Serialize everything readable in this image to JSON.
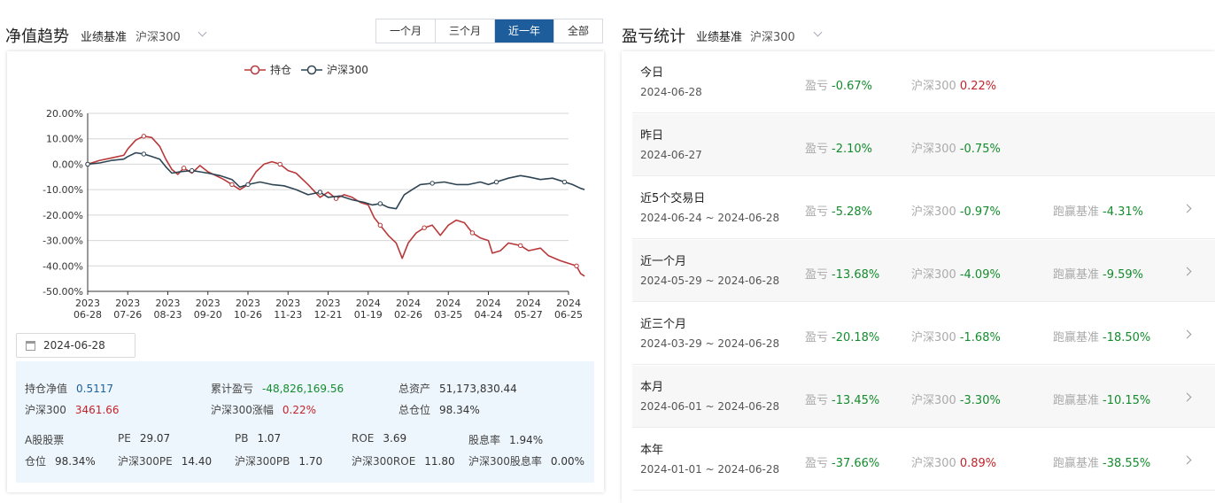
{
  "left": {
    "title": "净值趋势",
    "benchmark_label": "业绩基准",
    "benchmark_value": "沪深300",
    "range_tabs": [
      "一个月",
      "三个月",
      "近一年",
      "全部"
    ],
    "active_tab": 2,
    "date": "2024-06-28",
    "stats": {
      "nav_label": "持仓净值",
      "nav_value": "0.5117",
      "cum_pl_label": "累计盈亏",
      "cum_pl_value": "-48,826,169.56",
      "assets_label": "总资产",
      "assets_value": "51,173,830.44",
      "hs300_label": "沪深300",
      "hs300_value": "3461.66",
      "hs300_chg_label": "沪深300涨幅",
      "hs300_chg_value": "0.22%",
      "position_total_label": "总仓位",
      "position_total_value": "98.34%",
      "a_share_label": "A股股票",
      "pe_label": "PE",
      "pe_value": "29.07",
      "pb_label": "PB",
      "pb_value": "1.07",
      "roe_label": "ROE",
      "roe_value": "3.69",
      "div_label": "股息率",
      "div_value": "1.94%",
      "pos_label": "仓位",
      "pos_value": "98.34%",
      "hs_pe_label": "沪深300PE",
      "hs_pe_value": "14.40",
      "hs_pb_label": "沪深300PB",
      "hs_pb_value": "1.70",
      "hs_roe_label": "沪深300ROE",
      "hs_roe_value": "11.80",
      "hs_div_label": "沪深300股息率",
      "hs_div_value": "0.00%"
    }
  },
  "chart_data": {
    "type": "line",
    "y_unit": "%",
    "ylim": [
      -50,
      20
    ],
    "y_ticks": [
      "20.00%",
      "10.00%",
      "0.00%",
      "-10.00%",
      "-20.00%",
      "-30.00%",
      "-40.00%",
      "-50.00%"
    ],
    "x_ticks": [
      [
        "2023",
        "06-28"
      ],
      [
        "2023",
        "07-26"
      ],
      [
        "2023",
        "08-23"
      ],
      [
        "2023",
        "09-20"
      ],
      [
        "2023",
        "10-26"
      ],
      [
        "2023",
        "11-23"
      ],
      [
        "2023",
        "12-21"
      ],
      [
        "2024",
        "01-19"
      ],
      [
        "2024",
        "02-26"
      ],
      [
        "2024",
        "03-25"
      ],
      [
        "2024",
        "04-24"
      ],
      [
        "2024",
        "05-27"
      ],
      [
        "2024",
        "06-25"
      ]
    ],
    "legend_position": "top",
    "grid": true,
    "series": [
      {
        "name": "持仓",
        "color": "#b8383a",
        "points": [
          [
            0,
            0
          ],
          [
            0.3,
            1.5
          ],
          [
            0.6,
            2.5
          ],
          [
            0.9,
            3.5
          ],
          [
            1.0,
            6
          ],
          [
            1.2,
            9.5
          ],
          [
            1.4,
            11
          ],
          [
            1.6,
            10.5
          ],
          [
            1.8,
            7
          ],
          [
            1.95,
            2
          ],
          [
            2.1,
            -2
          ],
          [
            2.25,
            -4
          ],
          [
            2.4,
            -1.5
          ],
          [
            2.6,
            -3.5
          ],
          [
            2.8,
            -0.5
          ],
          [
            3.0,
            -3
          ],
          [
            3.2,
            -4.5
          ],
          [
            3.4,
            -6
          ],
          [
            3.6,
            -8
          ],
          [
            3.8,
            -10
          ],
          [
            4.0,
            -8
          ],
          [
            4.2,
            -3
          ],
          [
            4.4,
            0
          ],
          [
            4.6,
            1
          ],
          [
            4.8,
            0
          ],
          [
            5.0,
            -2.5
          ],
          [
            5.2,
            -3.5
          ],
          [
            5.5,
            -8
          ],
          [
            5.8,
            -13
          ],
          [
            6.0,
            -11
          ],
          [
            6.2,
            -13.5
          ],
          [
            6.4,
            -12
          ],
          [
            6.6,
            -13
          ],
          [
            6.8,
            -15
          ],
          [
            7.0,
            -16
          ],
          [
            7.15,
            -21
          ],
          [
            7.3,
            -24
          ],
          [
            7.5,
            -28
          ],
          [
            7.7,
            -31
          ],
          [
            7.85,
            -37
          ],
          [
            8.0,
            -31
          ],
          [
            8.2,
            -27
          ],
          [
            8.4,
            -25
          ],
          [
            8.6,
            -24
          ],
          [
            8.8,
            -28
          ],
          [
            9.0,
            -24
          ],
          [
            9.2,
            -22
          ],
          [
            9.4,
            -23
          ],
          [
            9.6,
            -27
          ],
          [
            9.8,
            -29
          ],
          [
            10.0,
            -30
          ],
          [
            10.1,
            -35
          ],
          [
            10.3,
            -34
          ],
          [
            10.5,
            -31
          ],
          [
            10.8,
            -32
          ],
          [
            11.0,
            -34
          ],
          [
            11.3,
            -33
          ],
          [
            11.5,
            -36
          ],
          [
            11.8,
            -38
          ],
          [
            12.0,
            -39
          ],
          [
            12.2,
            -40
          ],
          [
            12.3,
            -43
          ],
          [
            12.4,
            -44
          ]
        ]
      },
      {
        "name": "沪深300",
        "color": "#2f4554",
        "points": [
          [
            0,
            0
          ],
          [
            0.3,
            0.5
          ],
          [
            0.6,
            1.5
          ],
          [
            0.9,
            2
          ],
          [
            1.0,
            3
          ],
          [
            1.2,
            4.5
          ],
          [
            1.4,
            4
          ],
          [
            1.6,
            3
          ],
          [
            1.8,
            2
          ],
          [
            1.95,
            -1
          ],
          [
            2.1,
            -3.5
          ],
          [
            2.3,
            -3
          ],
          [
            2.6,
            -2.5
          ],
          [
            2.8,
            -3
          ],
          [
            3.0,
            -3.5
          ],
          [
            3.3,
            -4.5
          ],
          [
            3.6,
            -6
          ],
          [
            3.8,
            -9
          ],
          [
            4.0,
            -8
          ],
          [
            4.3,
            -7
          ],
          [
            4.6,
            -8
          ],
          [
            4.9,
            -8.5
          ],
          [
            5.2,
            -10
          ],
          [
            5.5,
            -12
          ],
          [
            5.8,
            -11
          ],
          [
            6.0,
            -13
          ],
          [
            6.3,
            -12.5
          ],
          [
            6.6,
            -14
          ],
          [
            6.9,
            -15
          ],
          [
            7.1,
            -16
          ],
          [
            7.3,
            -15.5
          ],
          [
            7.5,
            -17
          ],
          [
            7.7,
            -17.5
          ],
          [
            7.9,
            -12
          ],
          [
            8.1,
            -10
          ],
          [
            8.3,
            -8
          ],
          [
            8.6,
            -7.5
          ],
          [
            8.9,
            -7
          ],
          [
            9.2,
            -8
          ],
          [
            9.5,
            -8
          ],
          [
            9.8,
            -7
          ],
          [
            10.0,
            -8
          ],
          [
            10.2,
            -7
          ],
          [
            10.5,
            -5.5
          ],
          [
            10.8,
            -4.5
          ],
          [
            11.0,
            -5
          ],
          [
            11.3,
            -6
          ],
          [
            11.6,
            -5.5
          ],
          [
            11.9,
            -7
          ],
          [
            12.1,
            -8
          ],
          [
            12.3,
            -9.5
          ],
          [
            12.4,
            -10
          ]
        ]
      }
    ]
  },
  "right": {
    "title": "盈亏统计",
    "benchmark_label": "业绩基准",
    "benchmark_value": "沪深300",
    "rows": [
      {
        "name": "今日",
        "period": "2024-06-28",
        "pl_label": "盈亏",
        "pl": "-0.67%",
        "pl_sign": "neg",
        "hs_label": "沪深300",
        "hs": "0.22%",
        "hs_sign": "pos",
        "beat_label": "",
        "beat": "",
        "beat_sign": "",
        "arrow": false
      },
      {
        "name": "昨日",
        "period": "2024-06-27",
        "pl_label": "盈亏",
        "pl": "-2.10%",
        "pl_sign": "neg",
        "hs_label": "沪深300",
        "hs": "-0.75%",
        "hs_sign": "neg",
        "beat_label": "",
        "beat": "",
        "beat_sign": "",
        "arrow": false
      },
      {
        "name": "近5个交易日",
        "period": "2024-06-24 ~ 2024-06-28",
        "pl_label": "盈亏",
        "pl": "-5.28%",
        "pl_sign": "neg",
        "hs_label": "沪深300",
        "hs": "-0.97%",
        "hs_sign": "neg",
        "beat_label": "跑赢基准",
        "beat": "-4.31%",
        "beat_sign": "neg",
        "arrow": true
      },
      {
        "name": "近一个月",
        "period": "2024-05-29 ~ 2024-06-28",
        "pl_label": "盈亏",
        "pl": "-13.68%",
        "pl_sign": "neg",
        "hs_label": "沪深300",
        "hs": "-4.09%",
        "hs_sign": "neg",
        "beat_label": "跑赢基准",
        "beat": "-9.59%",
        "beat_sign": "neg",
        "arrow": true
      },
      {
        "name": "近三个月",
        "period": "2024-03-29 ~ 2024-06-28",
        "pl_label": "盈亏",
        "pl": "-20.18%",
        "pl_sign": "neg",
        "hs_label": "沪深300",
        "hs": "-1.68%",
        "hs_sign": "neg",
        "beat_label": "跑赢基准",
        "beat": "-18.50%",
        "beat_sign": "neg",
        "arrow": true
      },
      {
        "name": "本月",
        "period": "2024-06-01 ~ 2024-06-28",
        "pl_label": "盈亏",
        "pl": "-13.45%",
        "pl_sign": "neg",
        "hs_label": "沪深300",
        "hs": "-3.30%",
        "hs_sign": "neg",
        "beat_label": "跑赢基准",
        "beat": "-10.15%",
        "beat_sign": "neg",
        "arrow": true
      },
      {
        "name": "本年",
        "period": "2024-01-01 ~ 2024-06-28",
        "pl_label": "盈亏",
        "pl": "-37.66%",
        "pl_sign": "neg",
        "hs_label": "沪深300",
        "hs": "0.89%",
        "hs_sign": "pos",
        "beat_label": "跑赢基准",
        "beat": "-38.55%",
        "beat_sign": "neg",
        "arrow": true
      }
    ]
  }
}
